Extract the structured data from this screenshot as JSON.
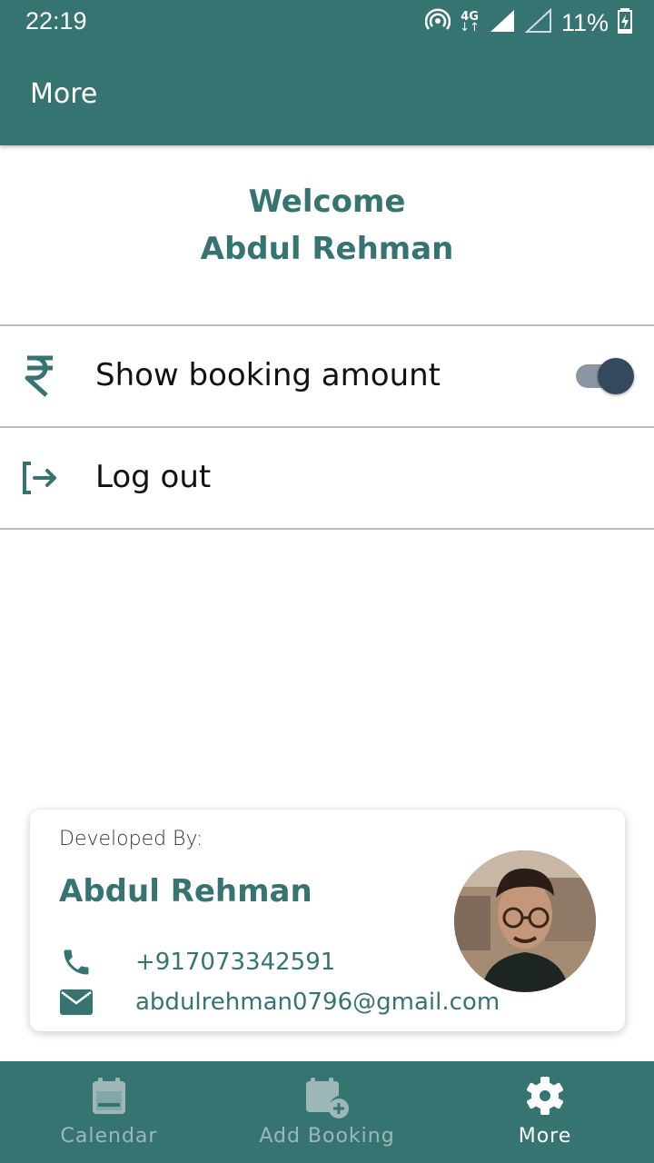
{
  "status_bar": {
    "time": "22:19",
    "network": "4G",
    "battery": "11%"
  },
  "app_bar": {
    "title": "More"
  },
  "welcome": {
    "line1": "Welcome",
    "name": "Abdul Rehman"
  },
  "settings": {
    "show_booking_amount": {
      "label": "Show booking amount",
      "icon": "rupee-icon",
      "enabled": true
    },
    "logout": {
      "label": "Log out",
      "icon": "logout-icon"
    }
  },
  "developer_card": {
    "label": "Developed By:",
    "name": "Abdul Rehman",
    "phone": "+917073342591",
    "email": "abdulrehman0796@gmail.com"
  },
  "bottom_nav": {
    "items": [
      {
        "label": "Calendar",
        "icon": "calendar-icon",
        "active": false
      },
      {
        "label": "Add Booking",
        "icon": "calendar-add-icon",
        "active": false
      },
      {
        "label": "More",
        "icon": "gear-icon",
        "active": true
      }
    ]
  },
  "colors": {
    "primary": "#367472",
    "toggle_thumb": "#34495e",
    "nav_inactive": "#9db8b7"
  }
}
